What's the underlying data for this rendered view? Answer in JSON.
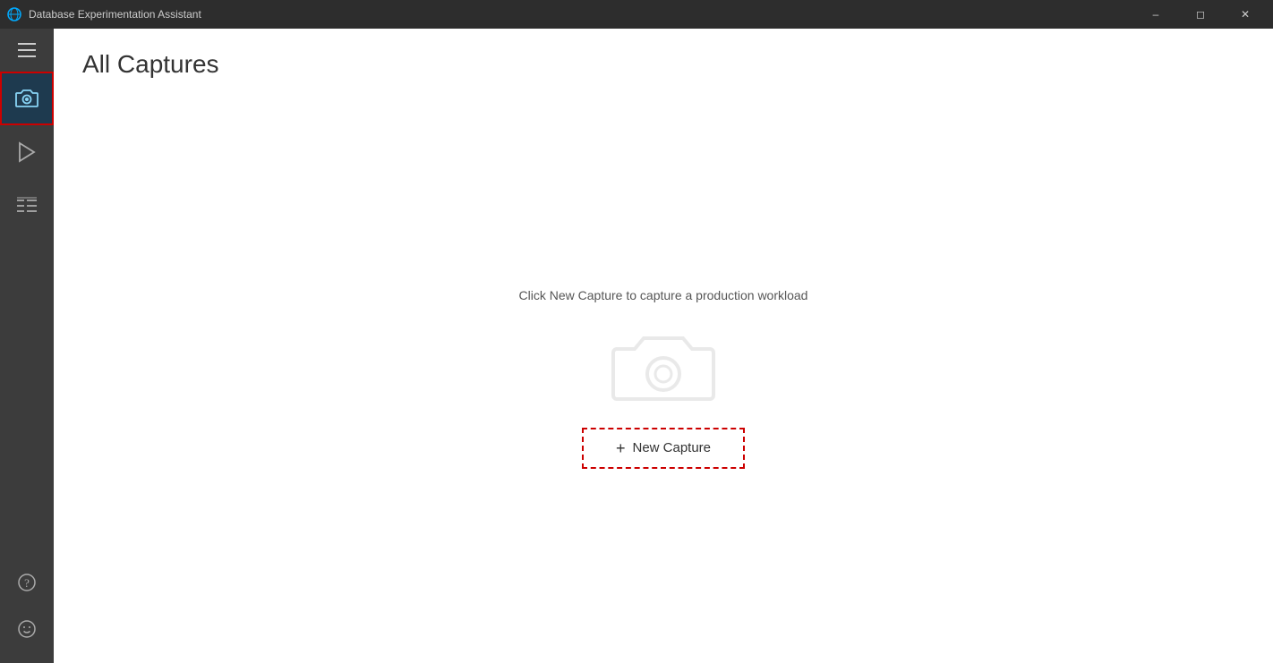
{
  "titleBar": {
    "appName": "Database Experimentation Assistant",
    "minimizeLabel": "–",
    "maximizeLabel": "◻",
    "closeLabel": "✕"
  },
  "sidebar": {
    "menuIcon": "hamburger-menu",
    "captureIcon": "camera-icon",
    "replayIcon": "play-icon",
    "analysisIcon": "list-icon",
    "helpIcon": "help-icon",
    "feedbackIcon": "smiley-icon"
  },
  "content": {
    "pageTitle": "All Captures",
    "emptyStateText": "Click New Capture to capture a production workload",
    "newCaptureLabel": "New Capture"
  }
}
